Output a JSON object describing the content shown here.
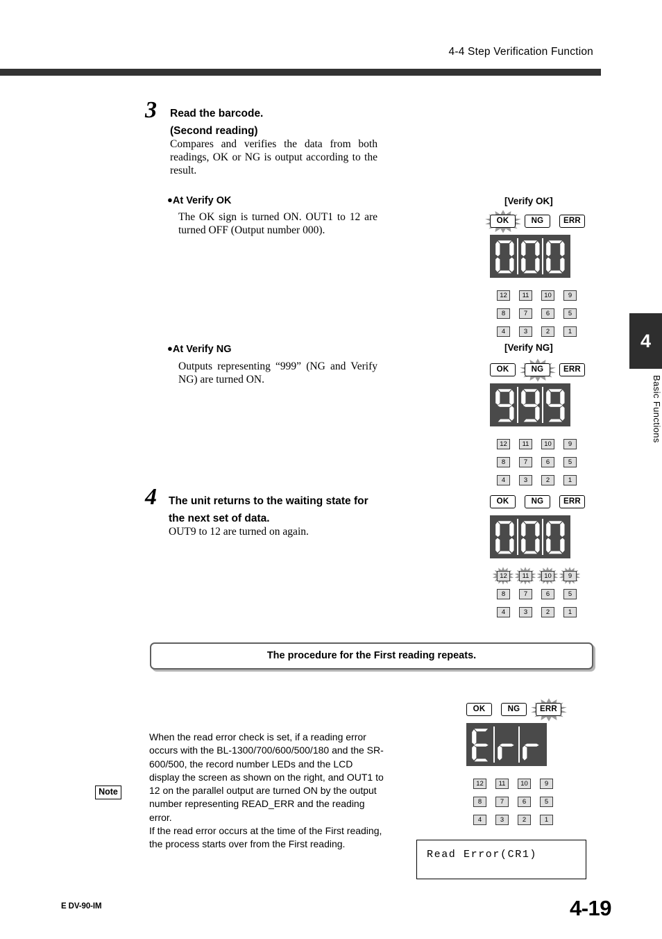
{
  "header": {
    "title": "4-4  Step Verification Function"
  },
  "chapter_tab": {
    "number": "4",
    "label": "Basic Functions"
  },
  "steps": [
    {
      "number": "3",
      "heading_line1": "Read the barcode.",
      "heading_line2": "(Second reading)",
      "body": "Compares and verifies the data from both readings, OK or NG is output according to the result."
    },
    {
      "number": "4",
      "heading_line1": "The unit returns to the waiting state for",
      "heading_line2": "the next set of data.",
      "body": "OUT9 to 12 are turned on again."
    }
  ],
  "bullets": [
    {
      "title": "At Verify OK",
      "body": "The OK sign is turned ON. OUT1 to 12 are turned OFF (Output number 000)."
    },
    {
      "title": "At Verify NG",
      "body": "Outputs representing “999” (NG and Verify NG) are turned ON."
    }
  ],
  "panels": [
    {
      "caption": "[Verify OK]",
      "badges": [
        {
          "label": "OK",
          "lit": true
        },
        {
          "label": "NG",
          "lit": false
        },
        {
          "label": "ERR",
          "lit": false
        }
      ],
      "display": "000",
      "grid_rows": [
        [
          {
            "label": "12",
            "lit": false
          },
          {
            "label": "11",
            "lit": false
          },
          {
            "label": "10",
            "lit": false
          },
          {
            "label": "9",
            "lit": false
          }
        ],
        [
          {
            "label": "8",
            "lit": false
          },
          {
            "label": "7",
            "lit": false
          },
          {
            "label": "6",
            "lit": false
          },
          {
            "label": "5",
            "lit": false
          }
        ],
        [
          {
            "label": "4",
            "lit": false
          },
          {
            "label": "3",
            "lit": false
          },
          {
            "label": "2",
            "lit": false
          },
          {
            "label": "1",
            "lit": false
          }
        ]
      ]
    },
    {
      "caption": "[Verify NG]",
      "badges": [
        {
          "label": "OK",
          "lit": false
        },
        {
          "label": "NG",
          "lit": true
        },
        {
          "label": "ERR",
          "lit": false
        }
      ],
      "display": "999",
      "grid_rows": [
        [
          {
            "label": "12",
            "lit": false
          },
          {
            "label": "11",
            "lit": false
          },
          {
            "label": "10",
            "lit": false
          },
          {
            "label": "9",
            "lit": false
          }
        ],
        [
          {
            "label": "8",
            "lit": false
          },
          {
            "label": "7",
            "lit": false
          },
          {
            "label": "6",
            "lit": false
          },
          {
            "label": "5",
            "lit": false
          }
        ],
        [
          {
            "label": "4",
            "lit": false
          },
          {
            "label": "3",
            "lit": false
          },
          {
            "label": "2",
            "lit": false
          },
          {
            "label": "1",
            "lit": false
          }
        ]
      ]
    },
    {
      "caption": "",
      "badges": [
        {
          "label": "OK",
          "lit": false
        },
        {
          "label": "NG",
          "lit": false
        },
        {
          "label": "ERR",
          "lit": false
        }
      ],
      "display": "000",
      "grid_rows": [
        [
          {
            "label": "12",
            "lit": true
          },
          {
            "label": "11",
            "lit": true
          },
          {
            "label": "10",
            "lit": true
          },
          {
            "label": "9",
            "lit": true
          }
        ],
        [
          {
            "label": "8",
            "lit": false
          },
          {
            "label": "7",
            "lit": false
          },
          {
            "label": "6",
            "lit": false
          },
          {
            "label": "5",
            "lit": false
          }
        ],
        [
          {
            "label": "4",
            "lit": false
          },
          {
            "label": "3",
            "lit": false
          },
          {
            "label": "2",
            "lit": false
          },
          {
            "label": "1",
            "lit": false
          }
        ]
      ]
    },
    {
      "caption": "",
      "badges": [
        {
          "label": "OK",
          "lit": false
        },
        {
          "label": "NG",
          "lit": false
        },
        {
          "label": "ERR",
          "lit": true
        }
      ],
      "display": "Err",
      "grid_rows": [
        [
          {
            "label": "12",
            "lit": false
          },
          {
            "label": "11",
            "lit": false
          },
          {
            "label": "10",
            "lit": false
          },
          {
            "label": "9",
            "lit": false
          }
        ],
        [
          {
            "label": "8",
            "lit": false
          },
          {
            "label": "7",
            "lit": false
          },
          {
            "label": "6",
            "lit": false
          },
          {
            "label": "5",
            "lit": false
          }
        ],
        [
          {
            "label": "4",
            "lit": false
          },
          {
            "label": "3",
            "lit": false
          },
          {
            "label": "2",
            "lit": false
          },
          {
            "label": "1",
            "lit": false
          }
        ]
      ]
    }
  ],
  "repeat_box": {
    "label": "The procedure for the First reading repeats."
  },
  "note": {
    "badge": "Note",
    "text": "When the read error check is set, if a reading error occurs with the BL-1300/700/600/500/180 and the SR-600/500, the record number LEDs and the LCD display the screen as shown on the right, and OUT1 to 12 on the parallel output are turned ON by the output number representing READ_ERR and the reading error.\nIf the read error occurs at the time of the First reading, the process starts over from the First reading."
  },
  "lcd": {
    "text": "Read Error(CR1)"
  },
  "footer": {
    "doc_id": "E DV-90-IM",
    "page_number": "4-19"
  },
  "colors": {
    "rule": "#333333",
    "tab": "#2e2e2e",
    "display_bg": "#4a4a4a",
    "flash": "#9a9a9a",
    "num_box": "#dedede"
  }
}
